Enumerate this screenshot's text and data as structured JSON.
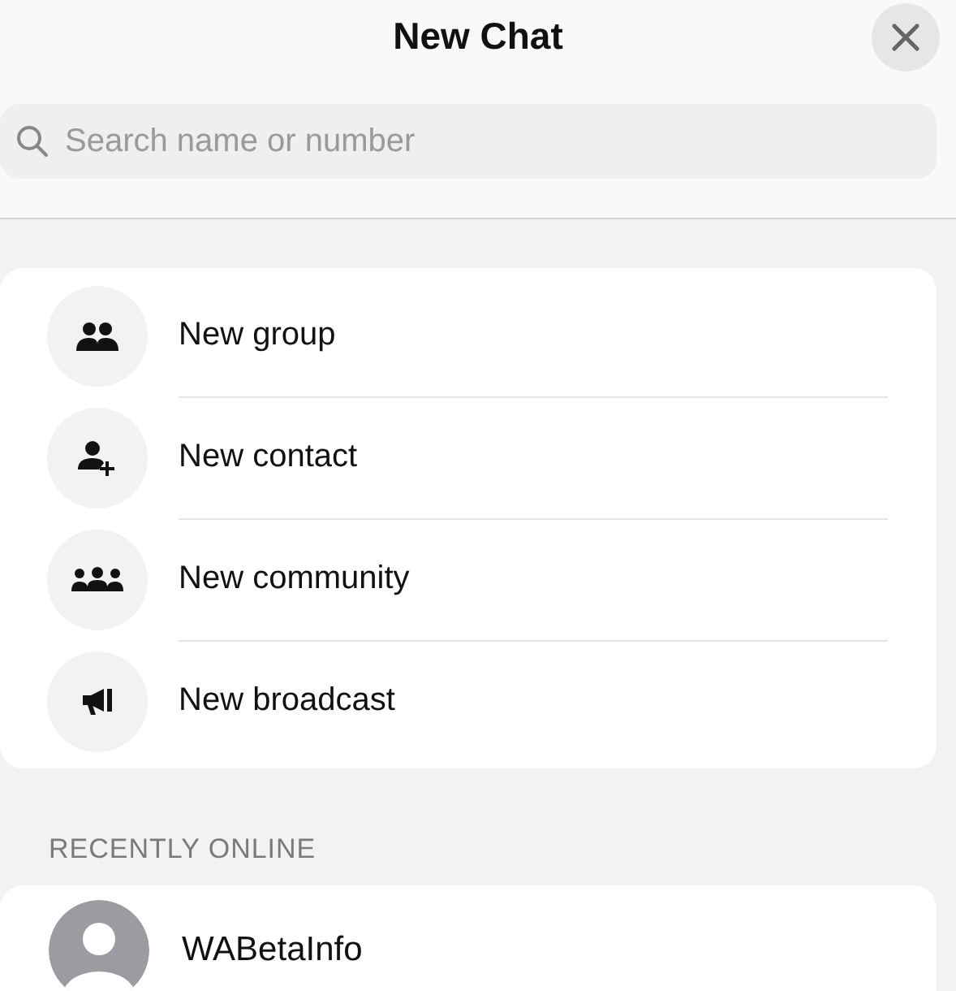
{
  "header": {
    "title": "New Chat"
  },
  "search": {
    "placeholder": "Search name or number"
  },
  "actions": [
    {
      "label": "New group"
    },
    {
      "label": "New contact"
    },
    {
      "label": "New community"
    },
    {
      "label": "New broadcast"
    }
  ],
  "recently_online": {
    "heading": "RECENTLY ONLINE",
    "contacts": [
      {
        "name": "WABetaInfo"
      }
    ]
  }
}
